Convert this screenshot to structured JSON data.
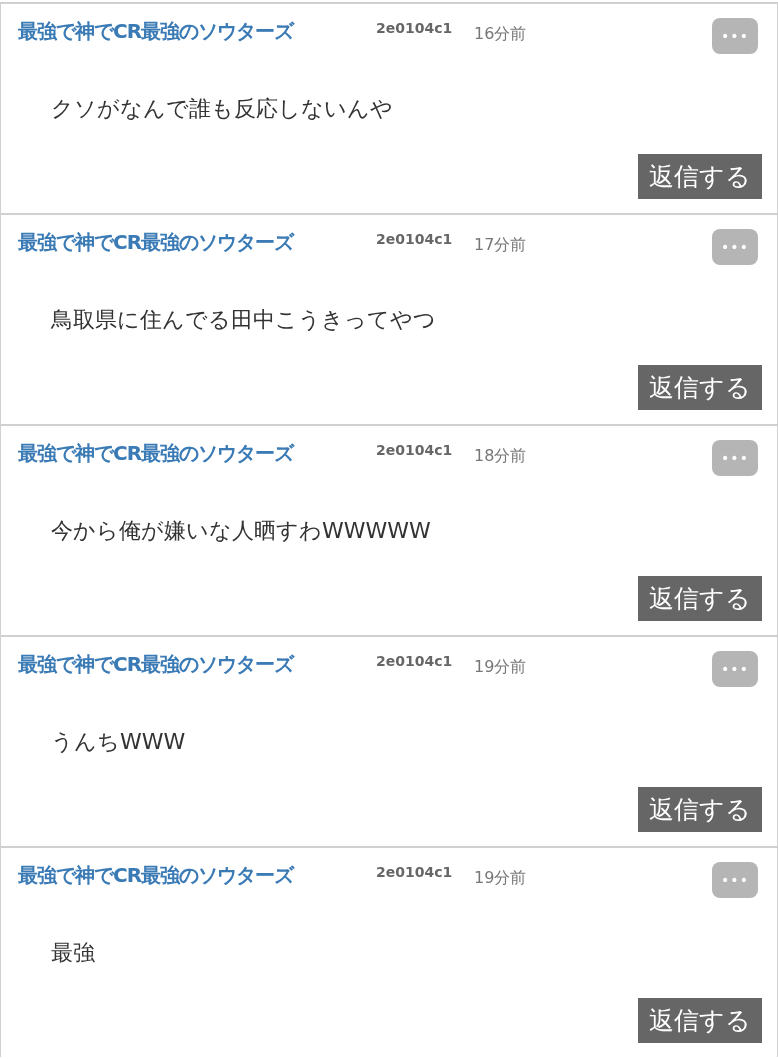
{
  "posts": [
    {
      "author": "最強で神でCR最強のソウターズ",
      "id": "2e0104c1",
      "time": "16分前",
      "more": "•••",
      "body": "クソがなんで誰も反応しないんや",
      "reply": "返信する"
    },
    {
      "author": "最強で神でCR最強のソウターズ",
      "id": "2e0104c1",
      "time": "17分前",
      "more": "•••",
      "body": "鳥取県に住んでる田中こうきってやつ",
      "reply": "返信する"
    },
    {
      "author": "最強で神でCR最強のソウターズ",
      "id": "2e0104c1",
      "time": "18分前",
      "more": "•••",
      "body": "今から俺が嫌いな人晒すわWWWWW",
      "reply": "返信する"
    },
    {
      "author": "最強で神でCR最強のソウターズ",
      "id": "2e0104c1",
      "time": "19分前",
      "more": "•••",
      "body": "うんちWWW",
      "reply": "返信する"
    },
    {
      "author": "最強で神でCR最強のソウターズ",
      "id": "2e0104c1",
      "time": "19分前",
      "more": "•••",
      "body": "最強",
      "reply": "返信する"
    }
  ]
}
